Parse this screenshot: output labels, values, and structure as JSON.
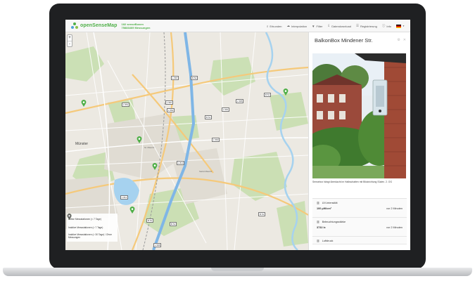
{
  "app": {
    "brand": "openSenseMap",
    "stats_boxes": "182 senseBoxen",
    "stats_measurements": "75883469 Messungen"
  },
  "nav": [
    {
      "icon": "search-icon",
      "glyph": "⌕",
      "label": "Erkunden"
    },
    {
      "icon": "cloud-icon",
      "glyph": "☁",
      "label": "Interpolation"
    },
    {
      "icon": "filter-icon",
      "glyph": "▼",
      "label": "Filter"
    },
    {
      "icon": "download-icon",
      "glyph": "⇩",
      "label": "Datendownload"
    },
    {
      "icon": "register-icon",
      "glyph": "☰",
      "label": "Registrierung"
    },
    {
      "icon": "info-icon",
      "glyph": "ⓘ",
      "label": "Info"
    }
  ],
  "map": {
    "zoom_in": "+",
    "zoom_out": "-",
    "places": {
      "muenster": "Münster",
      "st_mauritz": "St. Mauritz",
      "sankt_mauritz": "Sankt Mauritz"
    },
    "roads": [
      "B 54",
      "B 51",
      "L 587",
      "L 587",
      "L 582",
      "L 581",
      "B 51",
      "L 585",
      "L 551",
      "L 583",
      "B 51",
      "L 811",
      "B 51",
      "L 588",
      "L 813",
      "B 51"
    ],
    "legend": [
      {
        "label": "Aktive Messstationen (< 7 Tage)",
        "color": "#4eaf47"
      },
      {
        "label": "Inaktive Messstationen (> 7 Tage)",
        "color": "#7c8a3a"
      },
      {
        "label": "Inaktive Messstationen (> 30 Tage) / Ohne Messungen",
        "color": "#666666"
      }
    ],
    "markers": 7
  },
  "panel": {
    "title": "BalkonBox Mindener Str.",
    "caption": "Sensebox hängt überdacht im Halbschatten mit Blickrichtung Süden. 2. OG",
    "sensors": [
      {
        "icon": "chart-icon",
        "name": "UV-Intensität",
        "value": "100 µW/cm²",
        "time": "vor 2 Minuten"
      },
      {
        "icon": "chart-icon",
        "name": "Beleuchtungsstärke",
        "value": "3732 lx",
        "time": "vor 2 Minuten"
      },
      {
        "icon": "chart-icon",
        "name": "Luftdruck",
        "value": "",
        "time": ""
      }
    ]
  },
  "colors": {
    "brand": "#4eaf47",
    "water": "#a6d2ef",
    "map_bg": "#ece9e2"
  }
}
